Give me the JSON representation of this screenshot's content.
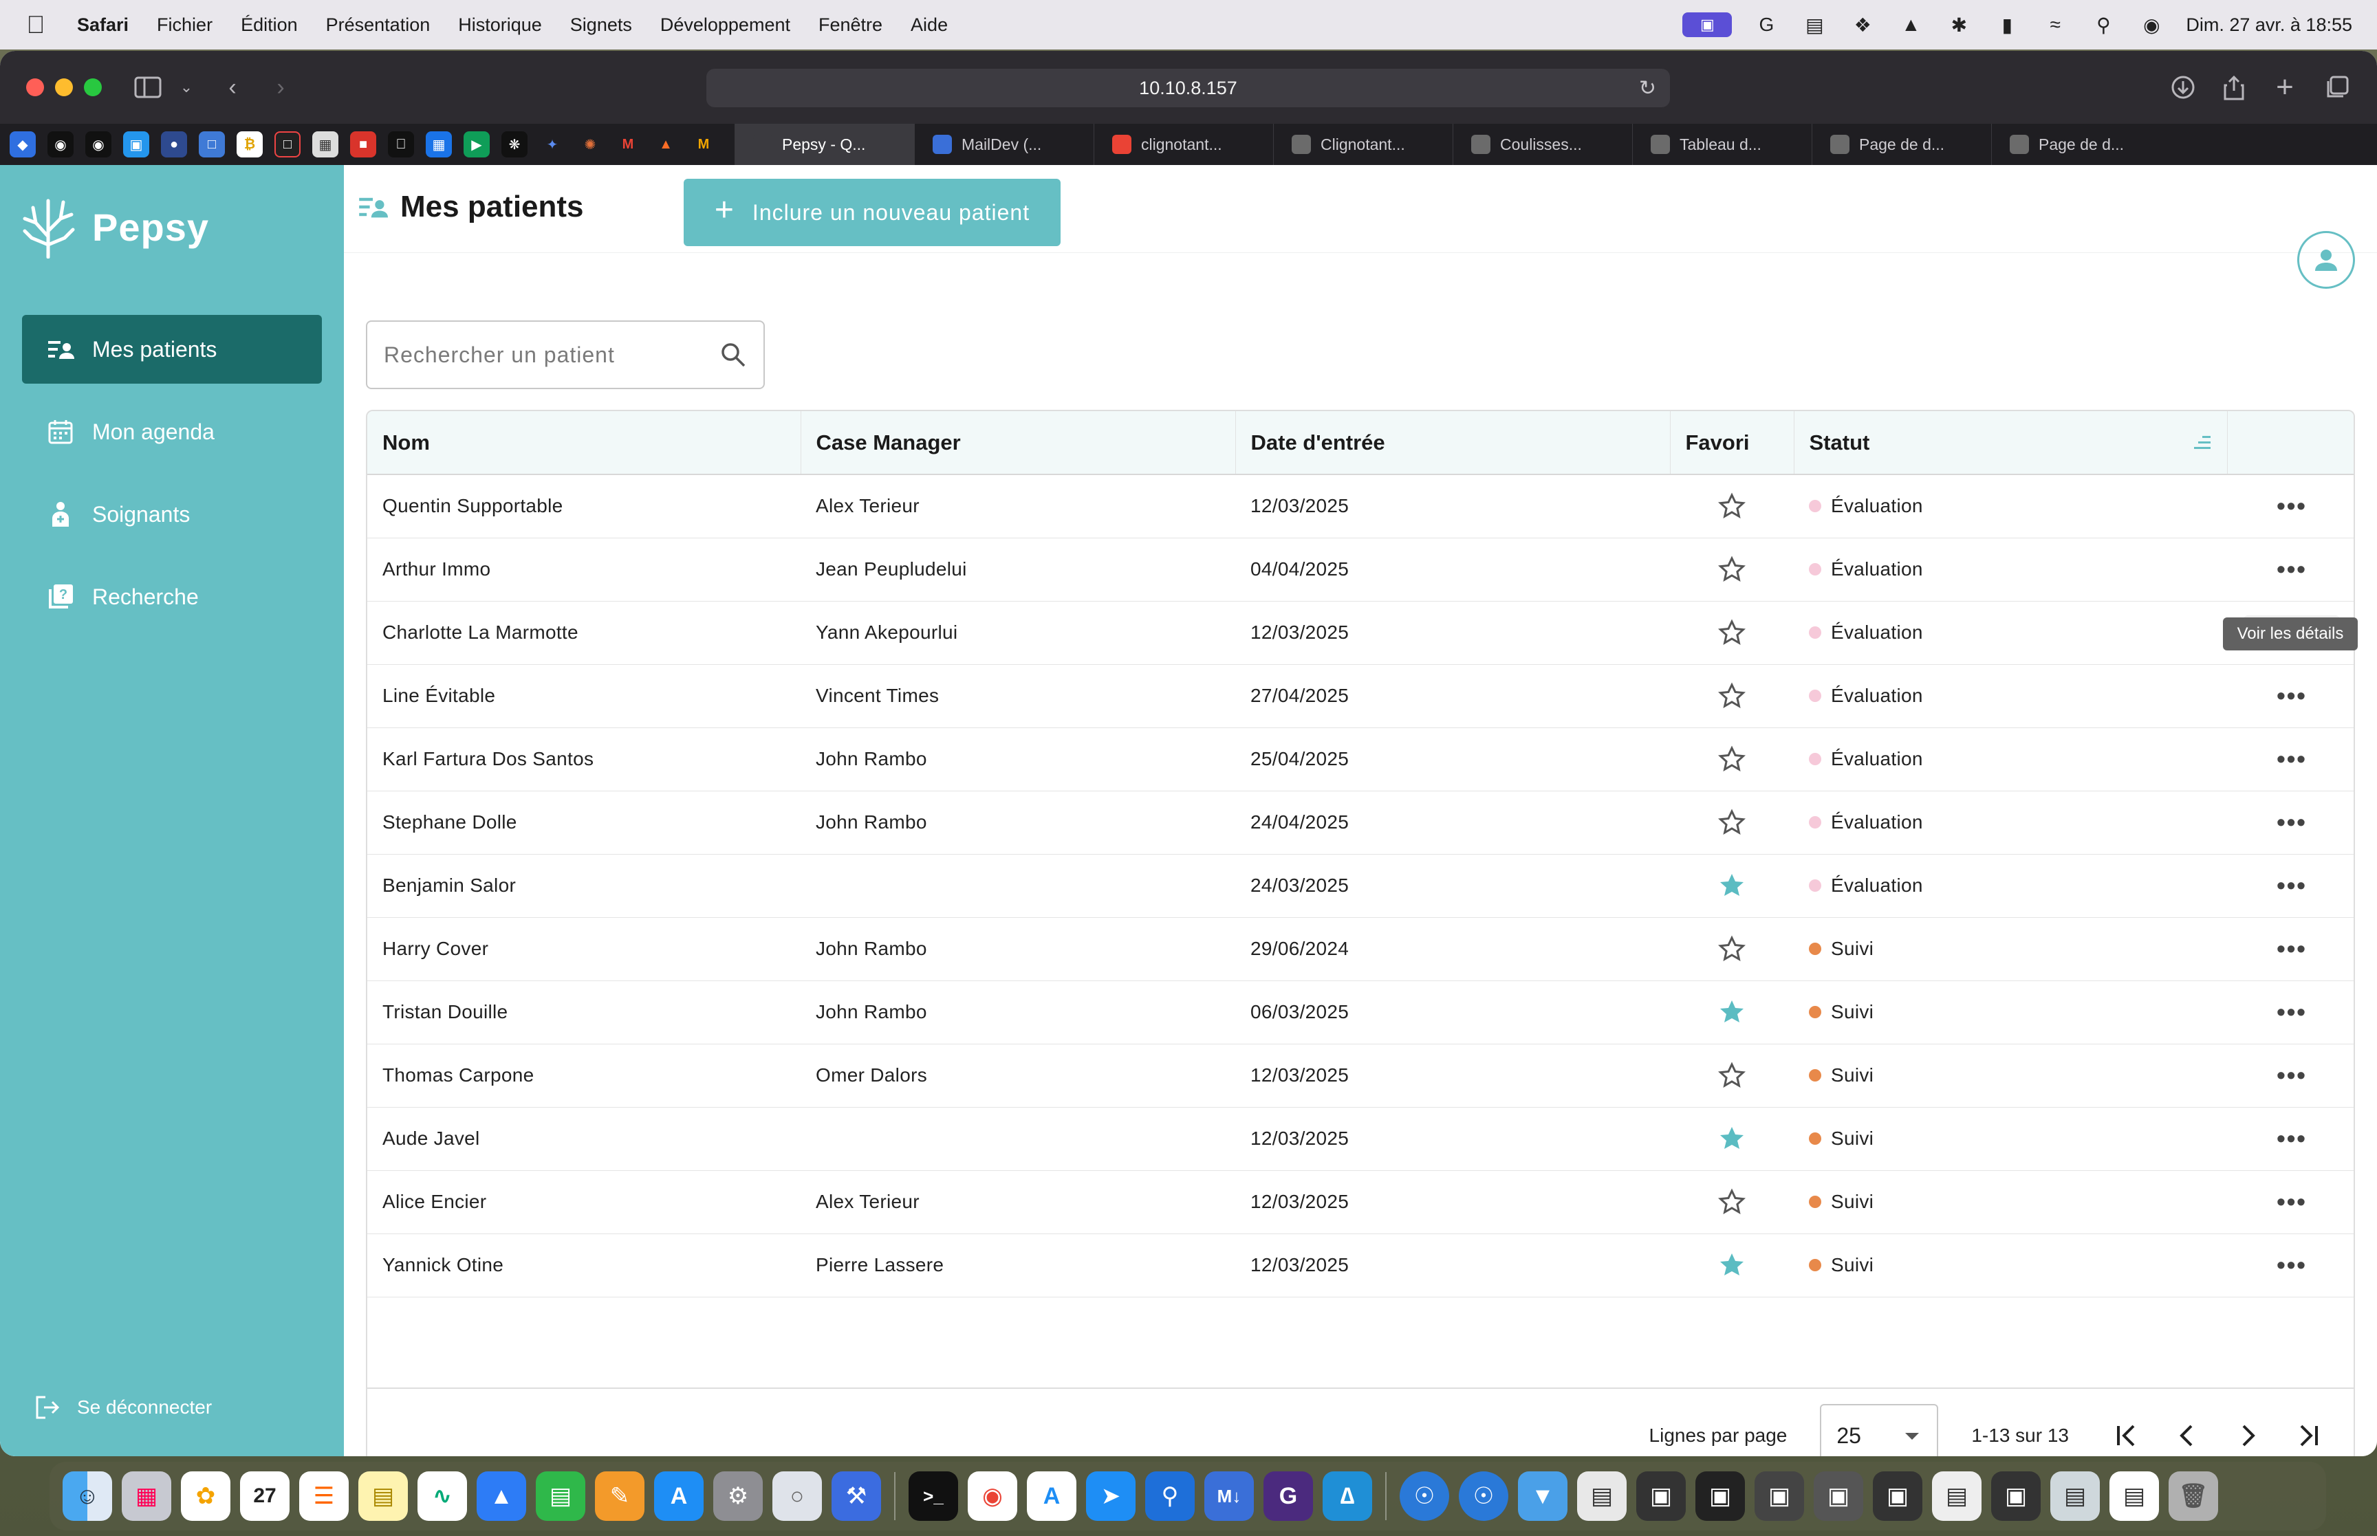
{
  "menubar": {
    "app": "Safari",
    "items": [
      "Fichier",
      "Édition",
      "Présentation",
      "Historique",
      "Signets",
      "Développement",
      "Fenêtre",
      "Aide"
    ],
    "clock": "Dim. 27 avr. à 18:55"
  },
  "browser": {
    "url": "10.10.8.157",
    "tabs": [
      {
        "label": "Pepsy - Q...",
        "color": "#3b3a3f"
      },
      {
        "label": "MailDev (...",
        "color": "#3a6fd8"
      },
      {
        "label": "clignotant...",
        "color": "#ea4335"
      },
      {
        "label": "Clignotant...",
        "color": "#6b6b6b"
      },
      {
        "label": "Coulisses...",
        "color": "#6b6b6b"
      },
      {
        "label": "Tableau d...",
        "color": "#6b6b6b"
      },
      {
        "label": "Page de d...",
        "color": "#6b6b6b"
      },
      {
        "label": "Page de d...",
        "color": "#6b6b6b"
      }
    ]
  },
  "sidebar": {
    "brand": "Pepsy",
    "nav": [
      {
        "label": "Mes patients",
        "icon": "patients-list-icon",
        "active": true
      },
      {
        "label": "Mon agenda",
        "icon": "calendar-icon",
        "active": false
      },
      {
        "label": "Soignants",
        "icon": "caregiver-icon",
        "active": false
      },
      {
        "label": "Recherche",
        "icon": "research-icon",
        "active": false
      }
    ],
    "logout": "Se déconnecter"
  },
  "header": {
    "title": "Mes patients",
    "new_patient_label": "Inclure un nouveau patient"
  },
  "search": {
    "placeholder": "Rechercher un patient"
  },
  "table": {
    "columns": [
      "Nom",
      "Case Manager",
      "Date d'entrée",
      "Favori",
      "Statut",
      ""
    ],
    "rows": [
      {
        "name": "Quentin Supportable",
        "manager": "Alex Terieur",
        "date": "12/03/2025",
        "favorite": false,
        "status": "Évaluation"
      },
      {
        "name": "Arthur Immo",
        "manager": "Jean Peupludelui",
        "date": "04/04/2025",
        "favorite": false,
        "status": "Évaluation"
      },
      {
        "name": "Charlotte La Marmotte",
        "manager": "Yann Akepourlui",
        "date": "12/03/2025",
        "favorite": false,
        "status": "Évaluation"
      },
      {
        "name": "Line Évitable",
        "manager": "Vincent Times",
        "date": "27/04/2025",
        "favorite": false,
        "status": "Évaluation"
      },
      {
        "name": "Karl Fartura Dos Santos",
        "manager": "John Rambo",
        "date": "25/04/2025",
        "favorite": false,
        "status": "Évaluation"
      },
      {
        "name": "Stephane Dolle",
        "manager": "John Rambo",
        "date": "24/04/2025",
        "favorite": false,
        "status": "Évaluation"
      },
      {
        "name": "Benjamin Salor",
        "manager": "",
        "date": "24/03/2025",
        "favorite": true,
        "status": "Évaluation"
      },
      {
        "name": "Harry Cover",
        "manager": "John Rambo",
        "date": "29/06/2024",
        "favorite": false,
        "status": "Suivi"
      },
      {
        "name": "Tristan Douille",
        "manager": "John Rambo",
        "date": "06/03/2025",
        "favorite": true,
        "status": "Suivi"
      },
      {
        "name": "Thomas Carpone",
        "manager": "Omer Dalors",
        "date": "12/03/2025",
        "favorite": false,
        "status": "Suivi"
      },
      {
        "name": "Aude Javel",
        "manager": "",
        "date": "12/03/2025",
        "favorite": true,
        "status": "Suivi"
      },
      {
        "name": "Alice Encier",
        "manager": "Alex Terieur",
        "date": "12/03/2025",
        "favorite": false,
        "status": "Suivi"
      },
      {
        "name": "Yannick Otine",
        "manager": "Pierre Lassere",
        "date": "12/03/2025",
        "favorite": true,
        "status": "Suivi"
      }
    ],
    "hovered_row": 2,
    "tooltip": "Voir les détails"
  },
  "status_colors": {
    "Évaluation": "#f6c9d9",
    "Suivi": "#e8894a"
  },
  "colors": {
    "accent": "#66bfc4",
    "nav_active": "#1b6b69",
    "star_filled": "#5bbcc2"
  },
  "pagination": {
    "rows_per_page_label": "Lignes par page",
    "rows_per_page": "25",
    "range": "1-13 sur 13"
  }
}
